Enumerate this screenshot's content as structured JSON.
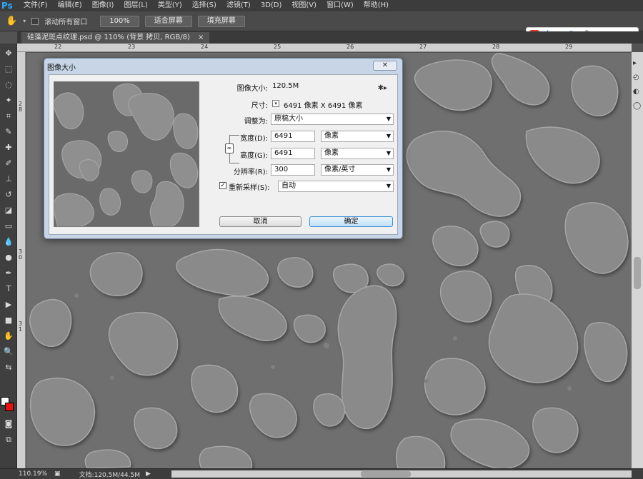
{
  "app": {
    "logo": "Ps"
  },
  "menu": [
    "文件(F)",
    "编辑(E)",
    "图像(I)",
    "图层(L)",
    "类型(Y)",
    "选择(S)",
    "滤镜(T)",
    "3D(D)",
    "视图(V)",
    "窗口(W)",
    "帮助(H)"
  ],
  "options": {
    "scroll_all": "滚动所有窗口",
    "btn_100": "100%",
    "btn_fit": "适合屏幕",
    "btn_fill": "填充屏幕"
  },
  "doc_tab": "硅藻泥斑点纹理.psd @ 110% (背景 拷贝, RGB/8)",
  "ime": {
    "logo": "S",
    "mode": "中"
  },
  "ruler": {
    "top_ticks": [
      "22",
      "23",
      "24",
      "25",
      "26",
      "27",
      "28",
      "29"
    ],
    "left_ticks": [
      "2",
      "8",
      "3",
      "0",
      "3",
      "1"
    ]
  },
  "status": {
    "zoom": "110.19%",
    "doc": "文档:120.5M/44.5M"
  },
  "dialog": {
    "title": "图像大小",
    "close": "✕",
    "image_size_label": "图像大小:",
    "image_size_value": "120.5M",
    "dimensions_label": "尺寸:",
    "dimensions_value": "6491 像素  X  6491 像素",
    "fit_to_label": "调整为:",
    "fit_to_value": "原稿大小",
    "width_label": "宽度(D):",
    "width_value": "6491",
    "width_unit": "像素",
    "height_label": "高度(G):",
    "height_value": "6491",
    "height_unit": "像素",
    "resolution_label": "分辨率(R):",
    "resolution_value": "300",
    "resolution_unit": "像素/英寸",
    "resample_label": "重新采样(S):",
    "resample_value": "自动",
    "cancel": "取消",
    "ok": "确定"
  },
  "colors": {
    "foreground": "#ffffff",
    "background": "#e81010",
    "canvas": "#6f6f6f",
    "accent": "#3c8fd6"
  }
}
